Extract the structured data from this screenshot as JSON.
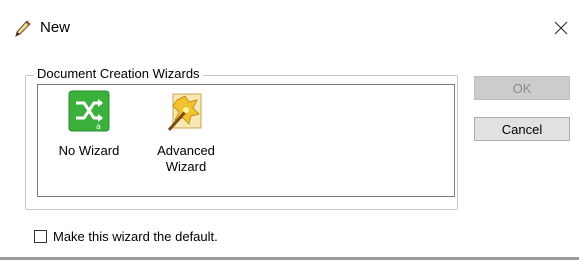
{
  "window": {
    "title": "New",
    "title_icon": "pencil-icon",
    "close_glyph": "✕"
  },
  "group": {
    "label": "Document Creation Wizards",
    "items": [
      {
        "label": "No Wizard",
        "icon": "no-wizard-icon",
        "accent": "#3bb03b"
      },
      {
        "label_line1": "Advanced",
        "label_line2": "Wizard",
        "icon": "magic-wand-icon",
        "accent": "#f2c230"
      }
    ]
  },
  "buttons": {
    "ok_label": "OK",
    "cancel_label": "Cancel"
  },
  "default_checkbox": {
    "label": "Make this wizard the default.",
    "checked": false
  }
}
